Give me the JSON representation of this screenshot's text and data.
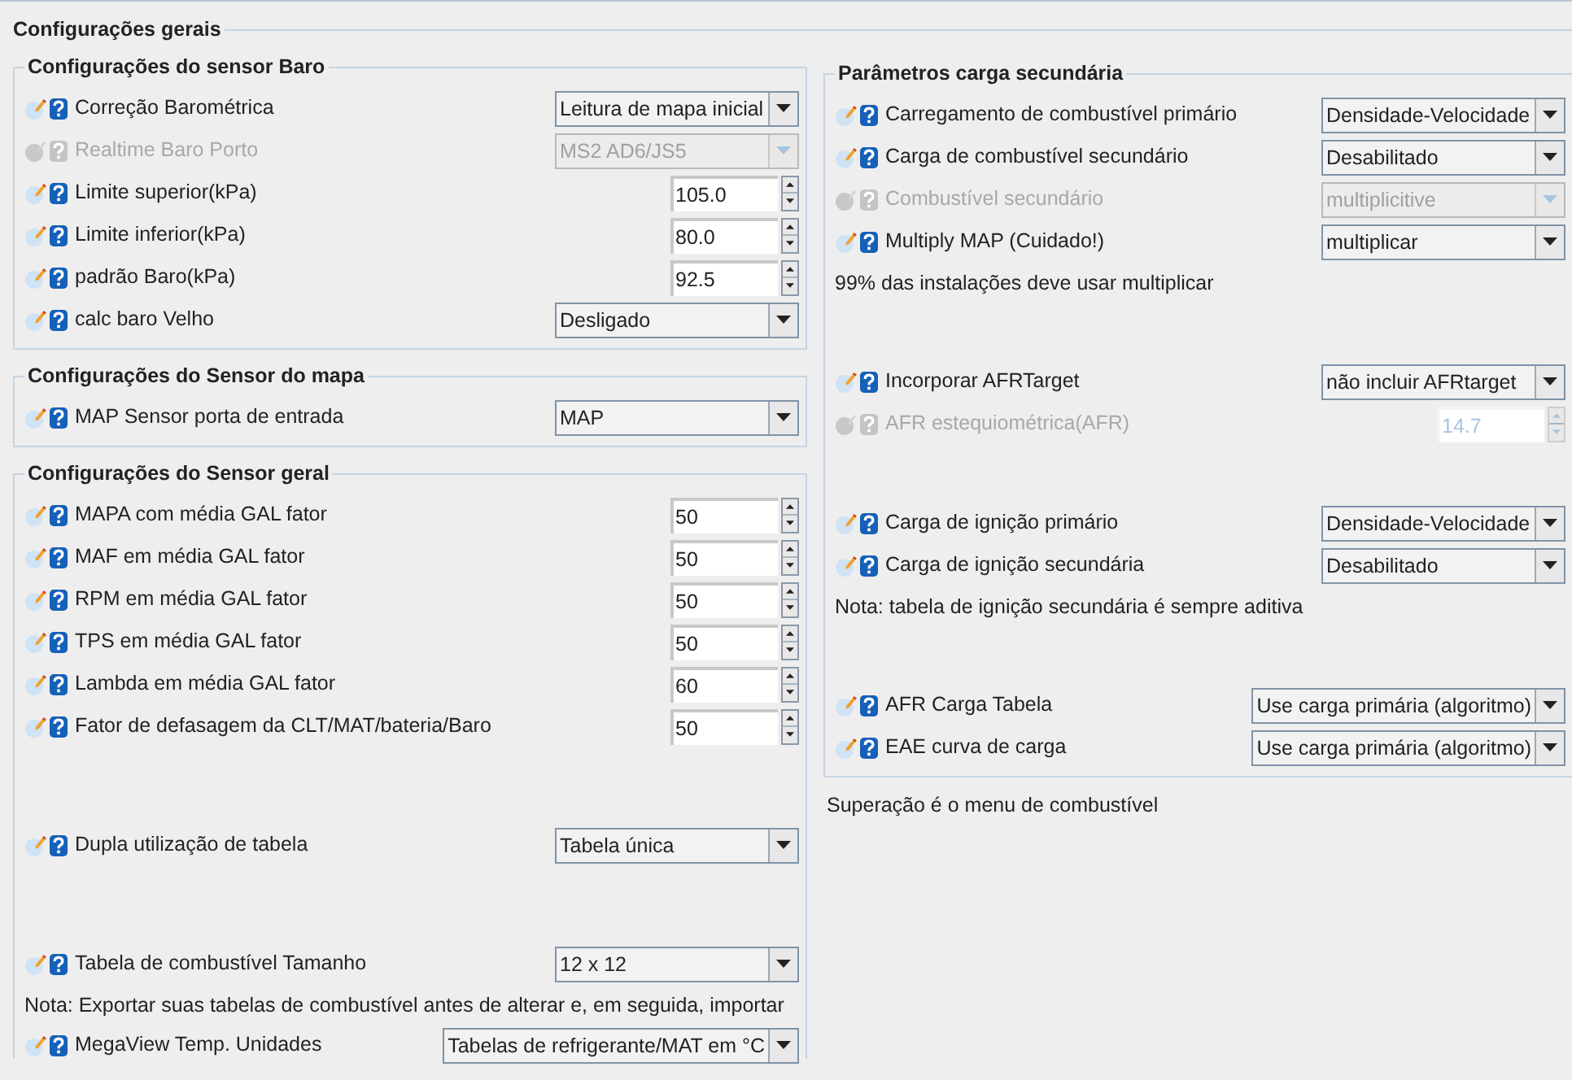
{
  "title": "Configurações gerais",
  "left_sections": [
    {
      "title": "Configurações do sensor Baro",
      "groups": [
        [
          {
            "kind": "select",
            "label": "Correção Barométrica",
            "value": "Leitura de mapa inicial",
            "disabled": false
          },
          {
            "kind": "select",
            "label": "Realtime Baro Porto",
            "value": "MS2 AD6/JS5",
            "disabled": true
          },
          {
            "kind": "spinner",
            "label": "Limite superior(kPa)",
            "value": "105.0",
            "disabled": false
          },
          {
            "kind": "spinner",
            "label": "Limite inferior(kPa)",
            "value": "80.0",
            "disabled": false
          },
          {
            "kind": "spinner",
            "label": "padrão Baro(kPa)",
            "value": "92.5",
            "disabled": false
          },
          {
            "kind": "select",
            "label": "calc baro Velho",
            "value": "Desligado",
            "disabled": false
          }
        ]
      ]
    },
    {
      "title": "Configurações do Sensor do mapa",
      "groups": [
        [
          {
            "kind": "select",
            "label": "MAP Sensor porta de entrada",
            "value": "MAP",
            "disabled": false
          }
        ]
      ]
    },
    {
      "title": "Configurações do Sensor geral",
      "groups": [
        [
          {
            "kind": "spinner",
            "label": "MAPA com média GAL fator",
            "value": "50",
            "disabled": false
          },
          {
            "kind": "spinner",
            "label": "MAF em média GAL fator",
            "value": "50",
            "disabled": false
          },
          {
            "kind": "spinner",
            "label": "RPM em média GAL fator",
            "value": "50",
            "disabled": false
          },
          {
            "kind": "spinner",
            "label": "TPS em média GAL fator",
            "value": "50",
            "disabled": false
          },
          {
            "kind": "spinner",
            "label": "Lambda em média GAL fator",
            "value": "60",
            "disabled": false
          },
          {
            "kind": "spinner",
            "label": "Fator de defasagem da CLT/MAT/bateria/Baro",
            "value": "50",
            "disabled": false
          }
        ],
        [
          {
            "kind": "select",
            "label": "Dupla utilização de tabela",
            "value": "Tabela única",
            "disabled": false
          }
        ],
        [
          {
            "kind": "select",
            "label": "Tabela de combustível Tamanho",
            "value": "12 x 12",
            "disabled": false
          },
          {
            "kind": "note",
            "text": "Nota: Exportar suas tabelas de combustível antes de alterar e, em seguida, importar"
          },
          {
            "kind": "select",
            "label": "MegaView Temp. Unidades",
            "value": "Tabelas de refrigerante/MAT em °C",
            "disabled": false
          }
        ]
      ]
    }
  ],
  "right_section": {
    "title": "Parâmetros carga secundária",
    "groups": [
      [
        {
          "kind": "select",
          "label": "Carregamento de combustível primário",
          "value": "Densidade-Velocidade",
          "disabled": false
        },
        {
          "kind": "select",
          "label": "Carga de combustível secundário",
          "value": "Desabilitado",
          "disabled": false
        },
        {
          "kind": "select",
          "label": "Combustível secundário",
          "value": "multiplicitive",
          "disabled": true
        },
        {
          "kind": "select",
          "label": "Multiply MAP (Cuidado!)",
          "value": "multiplicar",
          "disabled": false
        },
        {
          "kind": "note",
          "text": "99% das instalações deve usar multiplicar"
        }
      ],
      [
        {
          "kind": "select",
          "label": "Incorporar AFRTarget",
          "value": "não incluir AFRtarget",
          "disabled": false
        },
        {
          "kind": "spinner",
          "label": "AFR estequiométrica(AFR)",
          "value": "14.7",
          "disabled": true
        }
      ],
      [
        {
          "kind": "select",
          "label": "Carga de ignição primário",
          "value": "Densidade-Velocidade",
          "disabled": false
        },
        {
          "kind": "select",
          "label": "Carga de ignição secundária",
          "value": "Desabilitado",
          "disabled": false
        },
        {
          "kind": "note",
          "text": "Nota: tabela de ignição secundária é sempre aditiva"
        }
      ],
      [
        {
          "kind": "select",
          "label": "AFR Carga Tabela",
          "value": "Use carga primária (algoritmo)",
          "disabled": false
        },
        {
          "kind": "select",
          "label": "EAE curva de carga",
          "value": "Use carga primária (algoritmo)",
          "disabled": false
        }
      ]
    ]
  },
  "footer_note": "Superação é o menu de combustível"
}
